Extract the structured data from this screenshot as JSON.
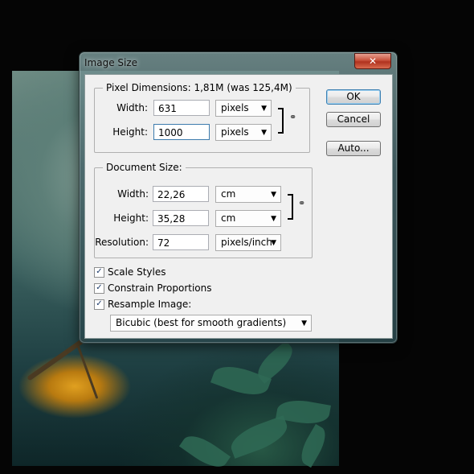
{
  "dialog": {
    "title": "Image Size",
    "close_label": "✕"
  },
  "pixel_dimensions": {
    "legend": "Pixel Dimensions:  1,81M (was 125,4M)",
    "width_label": "Width:",
    "width_value": "631",
    "width_unit": "pixels",
    "height_label": "Height:",
    "height_value": "1000",
    "height_unit": "pixels"
  },
  "document_size": {
    "legend": "Document Size:",
    "width_label": "Width:",
    "width_value": "22,26",
    "width_unit": "cm",
    "height_label": "Height:",
    "height_value": "35,28",
    "height_unit": "cm",
    "resolution_label": "Resolution:",
    "resolution_value": "72",
    "resolution_unit": "pixels/inch"
  },
  "options": {
    "scale_styles": {
      "label": "Scale Styles",
      "checked": true
    },
    "constrain_proportions": {
      "label": "Constrain Proportions",
      "checked": true
    },
    "resample_image": {
      "label": "Resample Image:",
      "checked": true
    },
    "resample_method": "Bicubic (best for smooth gradients)"
  },
  "buttons": {
    "ok": "OK",
    "cancel": "Cancel",
    "auto": "Auto..."
  },
  "colors": {
    "client_bg": "#f0f0f0",
    "default_button_border": "#3c7fb1",
    "close_button": "#c8503a"
  }
}
